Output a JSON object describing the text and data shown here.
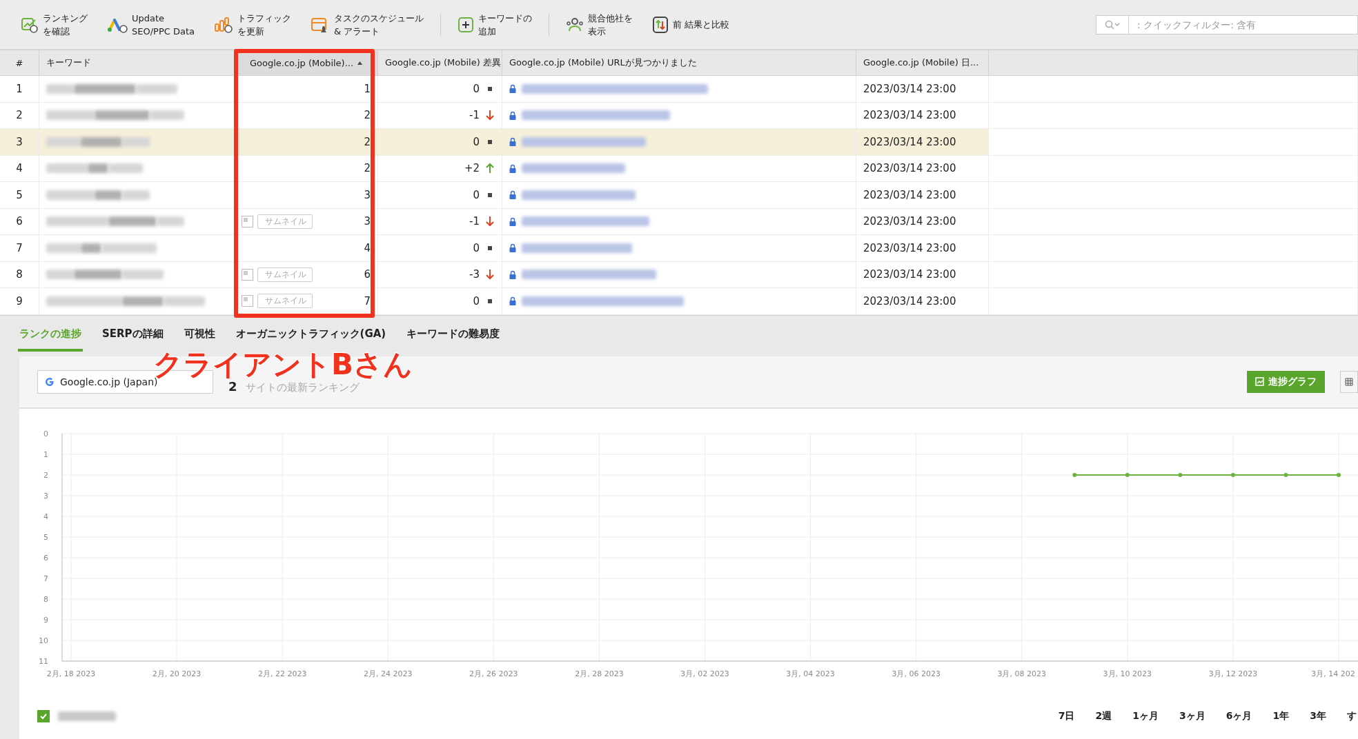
{
  "toolbar": [
    {
      "lines": [
        "ランキング",
        "を確認"
      ]
    },
    {
      "lines": [
        "Update",
        "SEO/PPC Data"
      ]
    },
    {
      "lines": [
        "トラフィック",
        "を更新"
      ]
    },
    {
      "lines": [
        "タスクのスケジュール",
        "& アラート"
      ]
    },
    {
      "lines": [
        "キーワードの",
        "追加"
      ]
    },
    {
      "lines": [
        "競合他社を",
        "表示"
      ]
    },
    {
      "lines": [
        "前 結果と比較"
      ]
    }
  ],
  "quick_filter": {
    "placeholder": ": クイックフィルター: 含有"
  },
  "table": {
    "columns": [
      {
        "label": "#",
        "sorted": false
      },
      {
        "label": "キーワード",
        "sorted": false
      },
      {
        "label": "Google.co.jp (Mobile)...",
        "sorted": true
      },
      {
        "label": "Google.co.jp (Mobile) 差異",
        "sorted": false
      },
      {
        "label": "Google.co.jp (Mobile) URLが見つかりました",
        "sorted": false
      },
      {
        "label": "Google.co.jp (Mobile) 日...",
        "sorted": false
      }
    ],
    "rows": [
      {
        "num": "1",
        "thumbnail": false,
        "rank": "1",
        "diff": "0",
        "kind": "same",
        "date": "2023/03/14 23:00",
        "selected": false
      },
      {
        "num": "2",
        "thumbnail": false,
        "rank": "2",
        "diff": "-1",
        "kind": "down",
        "date": "2023/03/14 23:00",
        "selected": false
      },
      {
        "num": "3",
        "thumbnail": false,
        "rank": "2",
        "diff": "0",
        "kind": "same",
        "date": "2023/03/14 23:00",
        "selected": true
      },
      {
        "num": "4",
        "thumbnail": false,
        "rank": "2",
        "diff": "+2",
        "kind": "up",
        "date": "2023/03/14 23:00",
        "selected": false
      },
      {
        "num": "5",
        "thumbnail": false,
        "rank": "3",
        "diff": "0",
        "kind": "same",
        "date": "2023/03/14 23:00",
        "selected": false
      },
      {
        "num": "6",
        "thumbnail": true,
        "thumbnail_label": "サムネイル",
        "rank": "3",
        "diff": "-1",
        "kind": "down",
        "date": "2023/03/14 23:00",
        "selected": false
      },
      {
        "num": "7",
        "thumbnail": false,
        "rank": "4",
        "diff": "0",
        "kind": "same",
        "date": "2023/03/14 23:00",
        "selected": false
      },
      {
        "num": "8",
        "thumbnail": true,
        "thumbnail_label": "サムネイル",
        "rank": "6",
        "diff": "-3",
        "kind": "down",
        "date": "2023/03/14 23:00",
        "selected": false
      },
      {
        "num": "9",
        "thumbnail": true,
        "thumbnail_label": "サムネイル",
        "rank": "7",
        "diff": "0",
        "kind": "same",
        "date": "2023/03/14 23:00",
        "selected": false
      }
    ]
  },
  "tabs": [
    {
      "label": "ランクの進捗",
      "selected": true
    },
    {
      "label": "SERPの詳細",
      "selected": false
    },
    {
      "label": "可視性",
      "selected": false
    },
    {
      "label": "オーガニックトラフィック(GA)",
      "selected": false
    },
    {
      "label": "キーワードの難易度",
      "selected": false
    }
  ],
  "engine_select": {
    "value": "Google.co.jp (Japan)"
  },
  "latest_rank": {
    "value": "2",
    "label": "サイトの最新ランキング"
  },
  "graph_button": {
    "label": "進捗グラフ",
    "selected": true
  },
  "annotation": {
    "text": "クライアントBさん"
  },
  "chart_data": {
    "type": "line",
    "categories": [
      "2月, 18 2023",
      null,
      "2月, 20 2023",
      null,
      "2月, 22 2023",
      null,
      "2月, 24 2023",
      null,
      "2月, 26 2023",
      null,
      "2月, 28 2023",
      null,
      "3月, 02 2023",
      null,
      "3月, 04 2023",
      null,
      "3月, 06 2023",
      null,
      "3月, 08 2023",
      null,
      "3月, 10 2023",
      null,
      "3月, 12 2023",
      null,
      "3月, 14 202"
    ],
    "series": [
      {
        "color": "#6cb33e",
        "marker": true,
        "values": [
          null,
          null,
          null,
          null,
          null,
          null,
          null,
          null,
          null,
          null,
          null,
          null,
          null,
          null,
          null,
          null,
          null,
          null,
          null,
          2,
          2,
          2,
          2,
          2,
          2
        ]
      }
    ],
    "ylim": [
      11,
      0
    ],
    "grid": true,
    "yticks": [
      0,
      1,
      2,
      3,
      4,
      5,
      6,
      7,
      8,
      9,
      10,
      11
    ]
  },
  "legend": {
    "checked": true
  },
  "ranges": [
    {
      "label": "7日"
    },
    {
      "label": "2週"
    },
    {
      "label": "1ヶ月"
    },
    {
      "label": "3ヶ月"
    },
    {
      "label": "6ヶ月"
    },
    {
      "label": "1年"
    },
    {
      "label": "3年"
    },
    {
      "label": "す"
    }
  ]
}
